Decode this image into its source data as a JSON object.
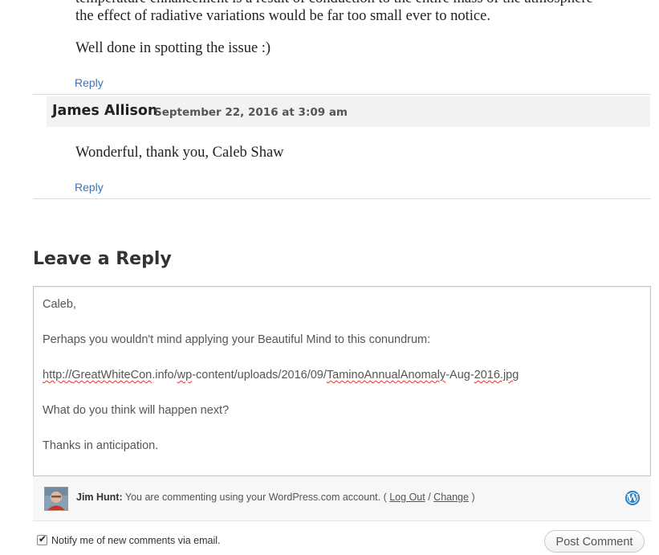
{
  "previous_comment": {
    "line1": "temperature enhancement is a result of conduction to the entire mass of the atmosphere",
    "line2": "the effect of radiative variations would be far too small ever to notice.",
    "line3": "Well done in spotting the issue :)",
    "reply_label": "Reply"
  },
  "reply_comment": {
    "author": "James Allison",
    "date": "September 22, 2016 at 3:09 am",
    "text": "Wonderful, thank you, Caleb Shaw",
    "reply_label": "Reply"
  },
  "leave_reply": {
    "title": "Leave a Reply",
    "textarea": {
      "line1": "Caleb,",
      "line2": "Perhaps you wouldn't mind applying your Beautiful Mind to this conundrum:",
      "line3_parts": [
        "http://",
        "GreatWhiteCon",
        ".info/",
        "wp",
        "-content/uploads/2016/09/",
        "TaminoAnnualAnomaly",
        "-Aug-",
        "2016.jpg"
      ],
      "line4": "What do you think will happen next?",
      "line5": "Thanks in anticipation."
    }
  },
  "identity": {
    "user_name": "Jim Hunt:",
    "message": "You are commenting using your WordPress.com account. (",
    "logout_label": "Log Out",
    "separator": "/",
    "change_label": "Change",
    "close_paren": ")",
    "service_icon": "wordpress-icon"
  },
  "notify": {
    "checked": true,
    "label": "Notify me of new comments via email."
  },
  "post_button": {
    "label": "Post Comment"
  },
  "colors": {
    "link": "#3a74b4",
    "author_bar": "#f2f2f2",
    "wordpress_blue": "#2e7fbf"
  }
}
